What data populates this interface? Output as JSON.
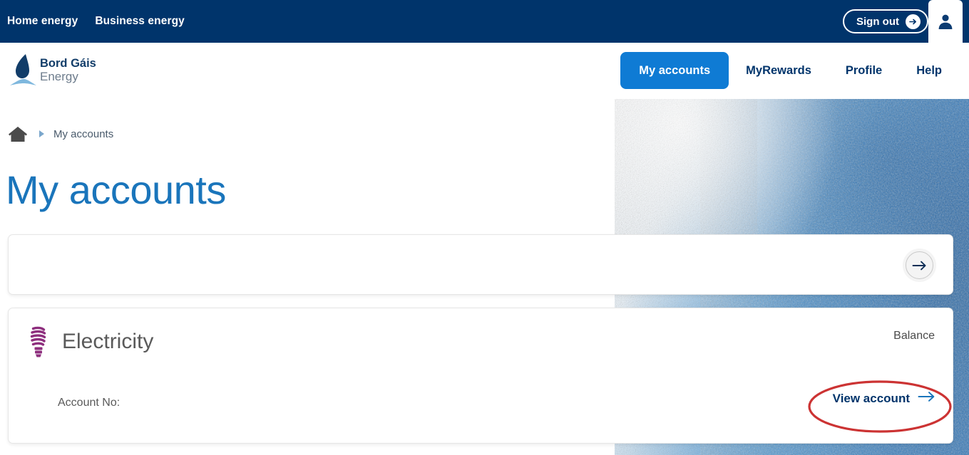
{
  "topbar": {
    "links": [
      {
        "label": "Home energy",
        "name": "home-energy"
      },
      {
        "label": "Business energy",
        "name": "business-energy"
      }
    ],
    "signout_label": "Sign out",
    "signout_icon": "arrow-right-circle-icon",
    "avatar_icon": "user-avatar-icon"
  },
  "brand": {
    "name_line1": "Bord Gáis",
    "name_line2": "Energy",
    "logo_icon": "bord-gais-energy-flame-logo"
  },
  "mainnav": {
    "items": [
      {
        "label": "My accounts",
        "active": true
      },
      {
        "label": "MyRewards",
        "active": false
      },
      {
        "label": "Profile",
        "active": false
      },
      {
        "label": "Help",
        "active": false
      }
    ]
  },
  "breadcrumb": {
    "home_icon": "home-icon",
    "separator_icon": "triangle-right-icon",
    "current": "My accounts"
  },
  "page": {
    "title": "My accounts"
  },
  "search_card": {
    "value": "",
    "placeholder": "",
    "submit_icon": "arrow-right-icon"
  },
  "account_card": {
    "icon": "light-bulb-icon",
    "type": "Electricity",
    "balance_label": "Balance",
    "balance_value": "",
    "account_no_label": "Account No:",
    "account_no_value": "",
    "view_account_label": "View account",
    "view_account_icon": "arrow-right-icon"
  },
  "annotation": {
    "shape": "red-ellipse-highlight",
    "target": "View account"
  },
  "colors": {
    "navy": "#00346b",
    "accent_blue": "#0f7bd4",
    "title_blue": "#1a75bb",
    "electricity_purple": "#8e2f7e",
    "annotation_red": "#cc3333",
    "page_bg": "#ffffff"
  }
}
